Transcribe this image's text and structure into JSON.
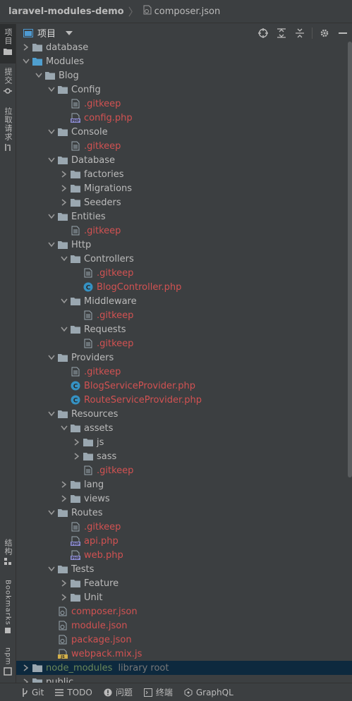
{
  "breadcrumb": {
    "project": "laravel-modules-demo",
    "file": "composer.json"
  },
  "leftbar": {
    "tabs": [
      "项目",
      "提交",
      "拉取请求",
      "结构",
      "Bookmarks",
      "npm"
    ]
  },
  "toolwindow": {
    "title": "项目"
  },
  "tree": [
    {
      "label": "database",
      "type": "dir",
      "depth": 1,
      "open": false
    },
    {
      "label": "Modules",
      "type": "dir-module",
      "depth": 1,
      "open": true
    },
    {
      "label": "Blog",
      "type": "dir",
      "depth": 2,
      "open": true
    },
    {
      "label": "Config",
      "type": "dir",
      "depth": 3,
      "open": true
    },
    {
      "label": ".gitkeep",
      "type": "file",
      "depth": 4
    },
    {
      "label": "config.php",
      "type": "php",
      "depth": 4
    },
    {
      "label": "Console",
      "type": "dir",
      "depth": 3,
      "open": true
    },
    {
      "label": ".gitkeep",
      "type": "file",
      "depth": 4
    },
    {
      "label": "Database",
      "type": "dir",
      "depth": 3,
      "open": true
    },
    {
      "label": "factories",
      "type": "dir",
      "depth": 4,
      "open": false
    },
    {
      "label": "Migrations",
      "type": "dir",
      "depth": 4,
      "open": false
    },
    {
      "label": "Seeders",
      "type": "dir",
      "depth": 4,
      "open": false
    },
    {
      "label": "Entities",
      "type": "dir",
      "depth": 3,
      "open": true
    },
    {
      "label": ".gitkeep",
      "type": "file",
      "depth": 4
    },
    {
      "label": "Http",
      "type": "dir",
      "depth": 3,
      "open": true
    },
    {
      "label": "Controllers",
      "type": "dir",
      "depth": 4,
      "open": true
    },
    {
      "label": ".gitkeep",
      "type": "file",
      "depth": 5
    },
    {
      "label": "BlogController.php",
      "type": "class",
      "depth": 5
    },
    {
      "label": "Middleware",
      "type": "dir",
      "depth": 4,
      "open": true
    },
    {
      "label": ".gitkeep",
      "type": "file",
      "depth": 5
    },
    {
      "label": "Requests",
      "type": "dir",
      "depth": 4,
      "open": true
    },
    {
      "label": ".gitkeep",
      "type": "file",
      "depth": 5
    },
    {
      "label": "Providers",
      "type": "dir",
      "depth": 3,
      "open": true
    },
    {
      "label": ".gitkeep",
      "type": "file",
      "depth": 4
    },
    {
      "label": "BlogServiceProvider.php",
      "type": "class",
      "depth": 4
    },
    {
      "label": "RouteServiceProvider.php",
      "type": "class",
      "depth": 4
    },
    {
      "label": "Resources",
      "type": "dir",
      "depth": 3,
      "open": true
    },
    {
      "label": "assets",
      "type": "dir",
      "depth": 4,
      "open": true
    },
    {
      "label": "js",
      "type": "dir",
      "depth": 5,
      "open": false
    },
    {
      "label": "sass",
      "type": "dir",
      "depth": 5,
      "open": false
    },
    {
      "label": ".gitkeep",
      "type": "file",
      "depth": 5
    },
    {
      "label": "lang",
      "type": "dir",
      "depth": 4,
      "open": false
    },
    {
      "label": "views",
      "type": "dir",
      "depth": 4,
      "open": false
    },
    {
      "label": "Routes",
      "type": "dir",
      "depth": 3,
      "open": true
    },
    {
      "label": ".gitkeep",
      "type": "file",
      "depth": 4
    },
    {
      "label": "api.php",
      "type": "php",
      "depth": 4
    },
    {
      "label": "web.php",
      "type": "php",
      "depth": 4
    },
    {
      "label": "Tests",
      "type": "dir",
      "depth": 3,
      "open": true
    },
    {
      "label": "Feature",
      "type": "dir",
      "depth": 4,
      "open": false
    },
    {
      "label": "Unit",
      "type": "dir",
      "depth": 4,
      "open": false
    },
    {
      "label": "composer.json",
      "type": "json",
      "depth": 3
    },
    {
      "label": "module.json",
      "type": "json",
      "depth": 3
    },
    {
      "label": "package.json",
      "type": "json",
      "depth": 3
    },
    {
      "label": "webpack.mix.js",
      "type": "js",
      "depth": 3
    },
    {
      "label": "node_modules",
      "type": "dir-lib",
      "depth": 1,
      "open": false,
      "hint": "library root",
      "selected": true
    },
    {
      "label": "public",
      "type": "dir",
      "depth": 1,
      "open": false
    }
  ],
  "status": [
    "Git",
    "TODO",
    "问题",
    "终端",
    "GraphQL"
  ]
}
